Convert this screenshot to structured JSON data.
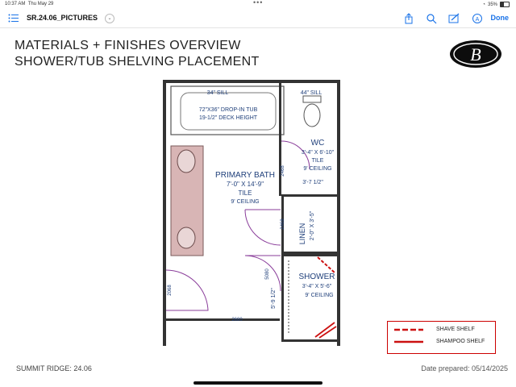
{
  "status_bar": {
    "time": "10:37 AM",
    "date": "Thu May 29",
    "battery": "35%"
  },
  "toolbar": {
    "document_title": "SR.24.06_PICTURES",
    "done_label": "Done",
    "icons": [
      "list-icon",
      "chevron-down-icon",
      "share-icon",
      "search-icon",
      "markup-icon",
      "pencil-circle-icon"
    ]
  },
  "header": {
    "title_line1": "MATERIALS + FINISHES OVERVIEW",
    "title_line2": "SHOWER/TUB SHELVING PLACEMENT",
    "logo_letter": "B"
  },
  "plan": {
    "tub_sill": "34\" SILL",
    "tub_label1": "72\"X36\" DROP-IN TUB",
    "tub_label2": "19-1/2\" DECK HEIGHT",
    "wc_sill": "44\" SILL",
    "wc_title": "WC",
    "wc_dims": "3'-4\" X 6'-10\"",
    "wc_floor": "TILE",
    "wc_ceiling": "9' CEILING",
    "bath_title": "PRIMARY BATH",
    "bath_dims": "7'-0\" X 14'-9\"",
    "bath_floor": "TILE",
    "bath_ceiling": "9' CEILING",
    "linen_title": "LINEN",
    "linen_dims": "2'-0\" X 3'-5\"",
    "wc_width": "3'-7 1/2\"",
    "door_2468_a": "2468",
    "door_2468_b": "2468",
    "door_2068": "2068",
    "door_5080": "5080",
    "door_2680": "2680",
    "shower_height": "5'-9 1/2\"",
    "shower_title": "SHOWER",
    "shower_dims": "3'-4\" X 5'-6\"",
    "shower_ceiling": "9' CEILING"
  },
  "legend": {
    "shave_shelf": "SHAVE SHELF",
    "shampoo_shelf": "SHAMPOO SHELF",
    "shelf_color": "#cc1111"
  },
  "footer": {
    "left": "SUMMIT RIDGE: 24.06",
    "right": "Date prepared: 05/14/2025"
  },
  "colors": {
    "accent": "#1a73e8",
    "plan_text": "#1f3f7a",
    "door_arc": "#8a3d9a",
    "vanity": "#d8b5b5"
  }
}
